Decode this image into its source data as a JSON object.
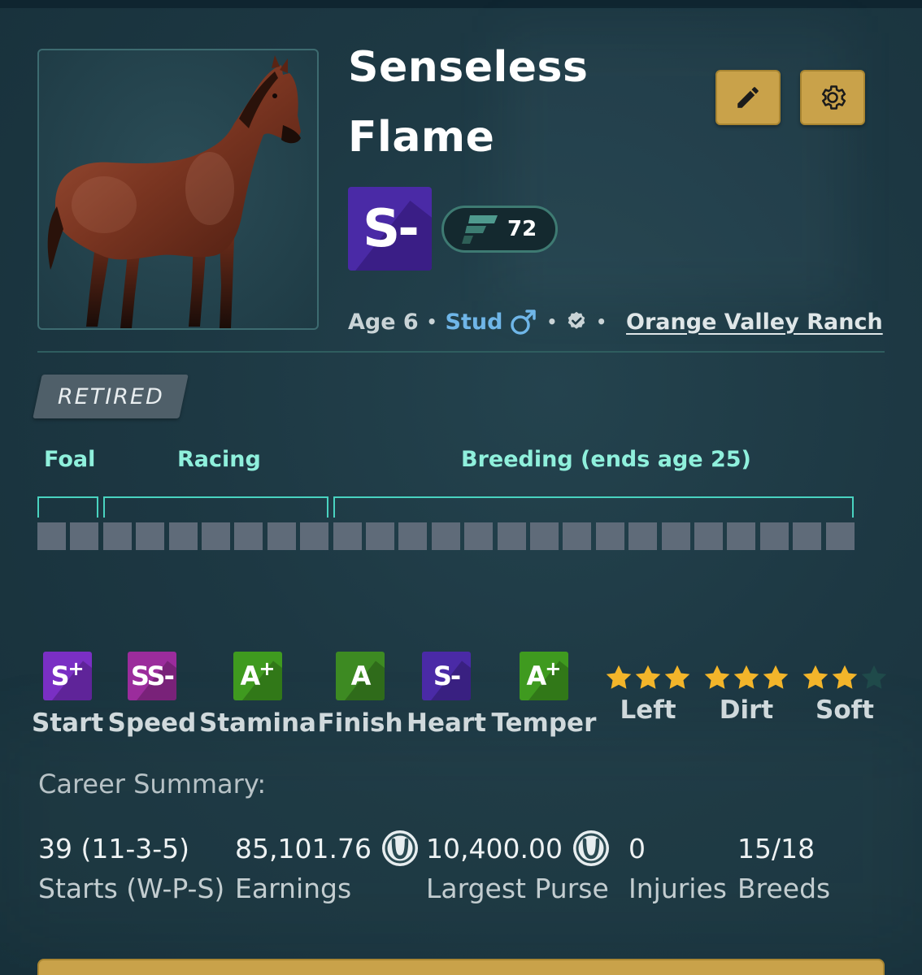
{
  "horse": {
    "name": "Senseless Flame",
    "grade": "S-",
    "rating": "72",
    "age": "Age 6",
    "sex": "Stud",
    "owner": "Orange Valley Ranch",
    "status": "RETIRED"
  },
  "buttons": {
    "edit_icon": "pencil-icon",
    "settings_icon": "gear-icon"
  },
  "lifecycle": {
    "stages": [
      {
        "label": "Foal"
      },
      {
        "label": "Racing"
      },
      {
        "label": "Breeding (ends age 25)"
      }
    ],
    "total_cells": 25,
    "filled_cells": 0
  },
  "skills": [
    {
      "grade": "S",
      "sup": "+",
      "label": "Start",
      "color": "#7a2fc4"
    },
    {
      "grade": "SS-",
      "sup": "",
      "label": "Speed",
      "color": "#9b2c9c"
    },
    {
      "grade": "A",
      "sup": "+",
      "label": "Stamina",
      "color": "#3f9a1f"
    },
    {
      "grade": "A",
      "sup": "",
      "label": "Finish",
      "color": "#3d8a22"
    },
    {
      "grade": "S-",
      "sup": "",
      "label": "Heart",
      "color": "#4a2aa6"
    },
    {
      "grade": "A",
      "sup": "+",
      "label": "Temper",
      "color": "#3f9a1f"
    }
  ],
  "preferences": [
    {
      "label": "Left",
      "stars": 3,
      "max": 3
    },
    {
      "label": "Dirt",
      "stars": 3,
      "max": 3
    },
    {
      "label": "Soft",
      "stars": 2,
      "max": 3
    }
  ],
  "career": {
    "title": "Career Summary:",
    "stats": [
      {
        "value": "39 (11-3-5)",
        "caption": "Starts (W-P-S)",
        "coin": false
      },
      {
        "value": "85,101.76",
        "caption": "Earnings",
        "coin": true
      },
      {
        "value": "10,400.00",
        "caption": "Largest Purse",
        "coin": true
      },
      {
        "value": "0",
        "caption": "Injuries",
        "coin": false
      },
      {
        "value": "15/18",
        "caption": "Breeds",
        "coin": false
      }
    ]
  },
  "colors": {
    "accent_gold": "#c9a24a",
    "teal": "#49d3c0",
    "stud_blue": "#6fb6e8",
    "star": "#f3b52a"
  }
}
